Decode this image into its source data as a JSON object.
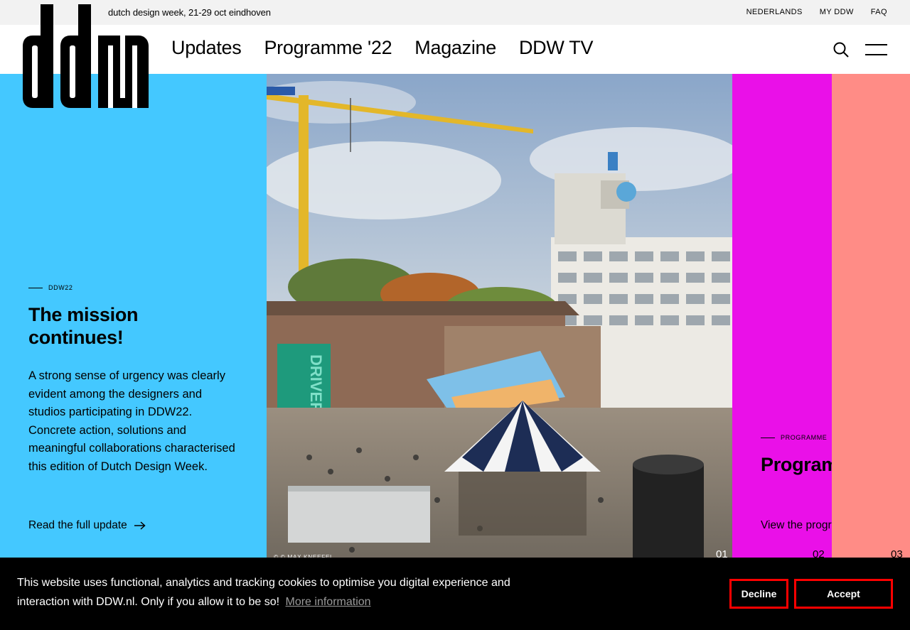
{
  "topbar": {
    "tagline": "dutch design week, 21-29 oct eindhoven",
    "links": [
      "NEDERLANDS",
      "MY DDW",
      "FAQ"
    ]
  },
  "nav": {
    "items": [
      "Updates",
      "Programme '22",
      "Magazine",
      "DDW TV"
    ],
    "search_icon": "search-icon",
    "menu_icon": "hamburger-menu-icon"
  },
  "logo": {
    "text": "ddw",
    "icon": "ddw-logo"
  },
  "panels": [
    {
      "eyebrow": "DDW22",
      "title_line1": "The mission",
      "title_line2": "continues!",
      "body": "A strong sense of urgency was clearly evident among the designers and studios participating in DDW22. Concrete action, solutions and meaningful collaborations characterised this edition of Dutch Design Week.",
      "cta": "Read the full update",
      "cta_icon": "arrow-right-icon",
      "number": "01",
      "photo_credit": "© © MAX KNEEFEL",
      "color": "#44c8ff"
    },
    {
      "eyebrow": "PROGRAMME",
      "title": "Programme",
      "cta": "View the programme",
      "number": "02",
      "color": "#ea10e8"
    },
    {
      "number": "03",
      "color": "#ff8c86"
    }
  ],
  "photo": {
    "banner_text": "DRIVERS OF CHANGE"
  },
  "cookie": {
    "message": "This website uses functional, analytics and tracking cookies to optimise you digital experience and interaction with DDW.nl. Only if you allow it to be so!",
    "more_info": "More information",
    "decline": "Decline",
    "accept": "Accept"
  }
}
